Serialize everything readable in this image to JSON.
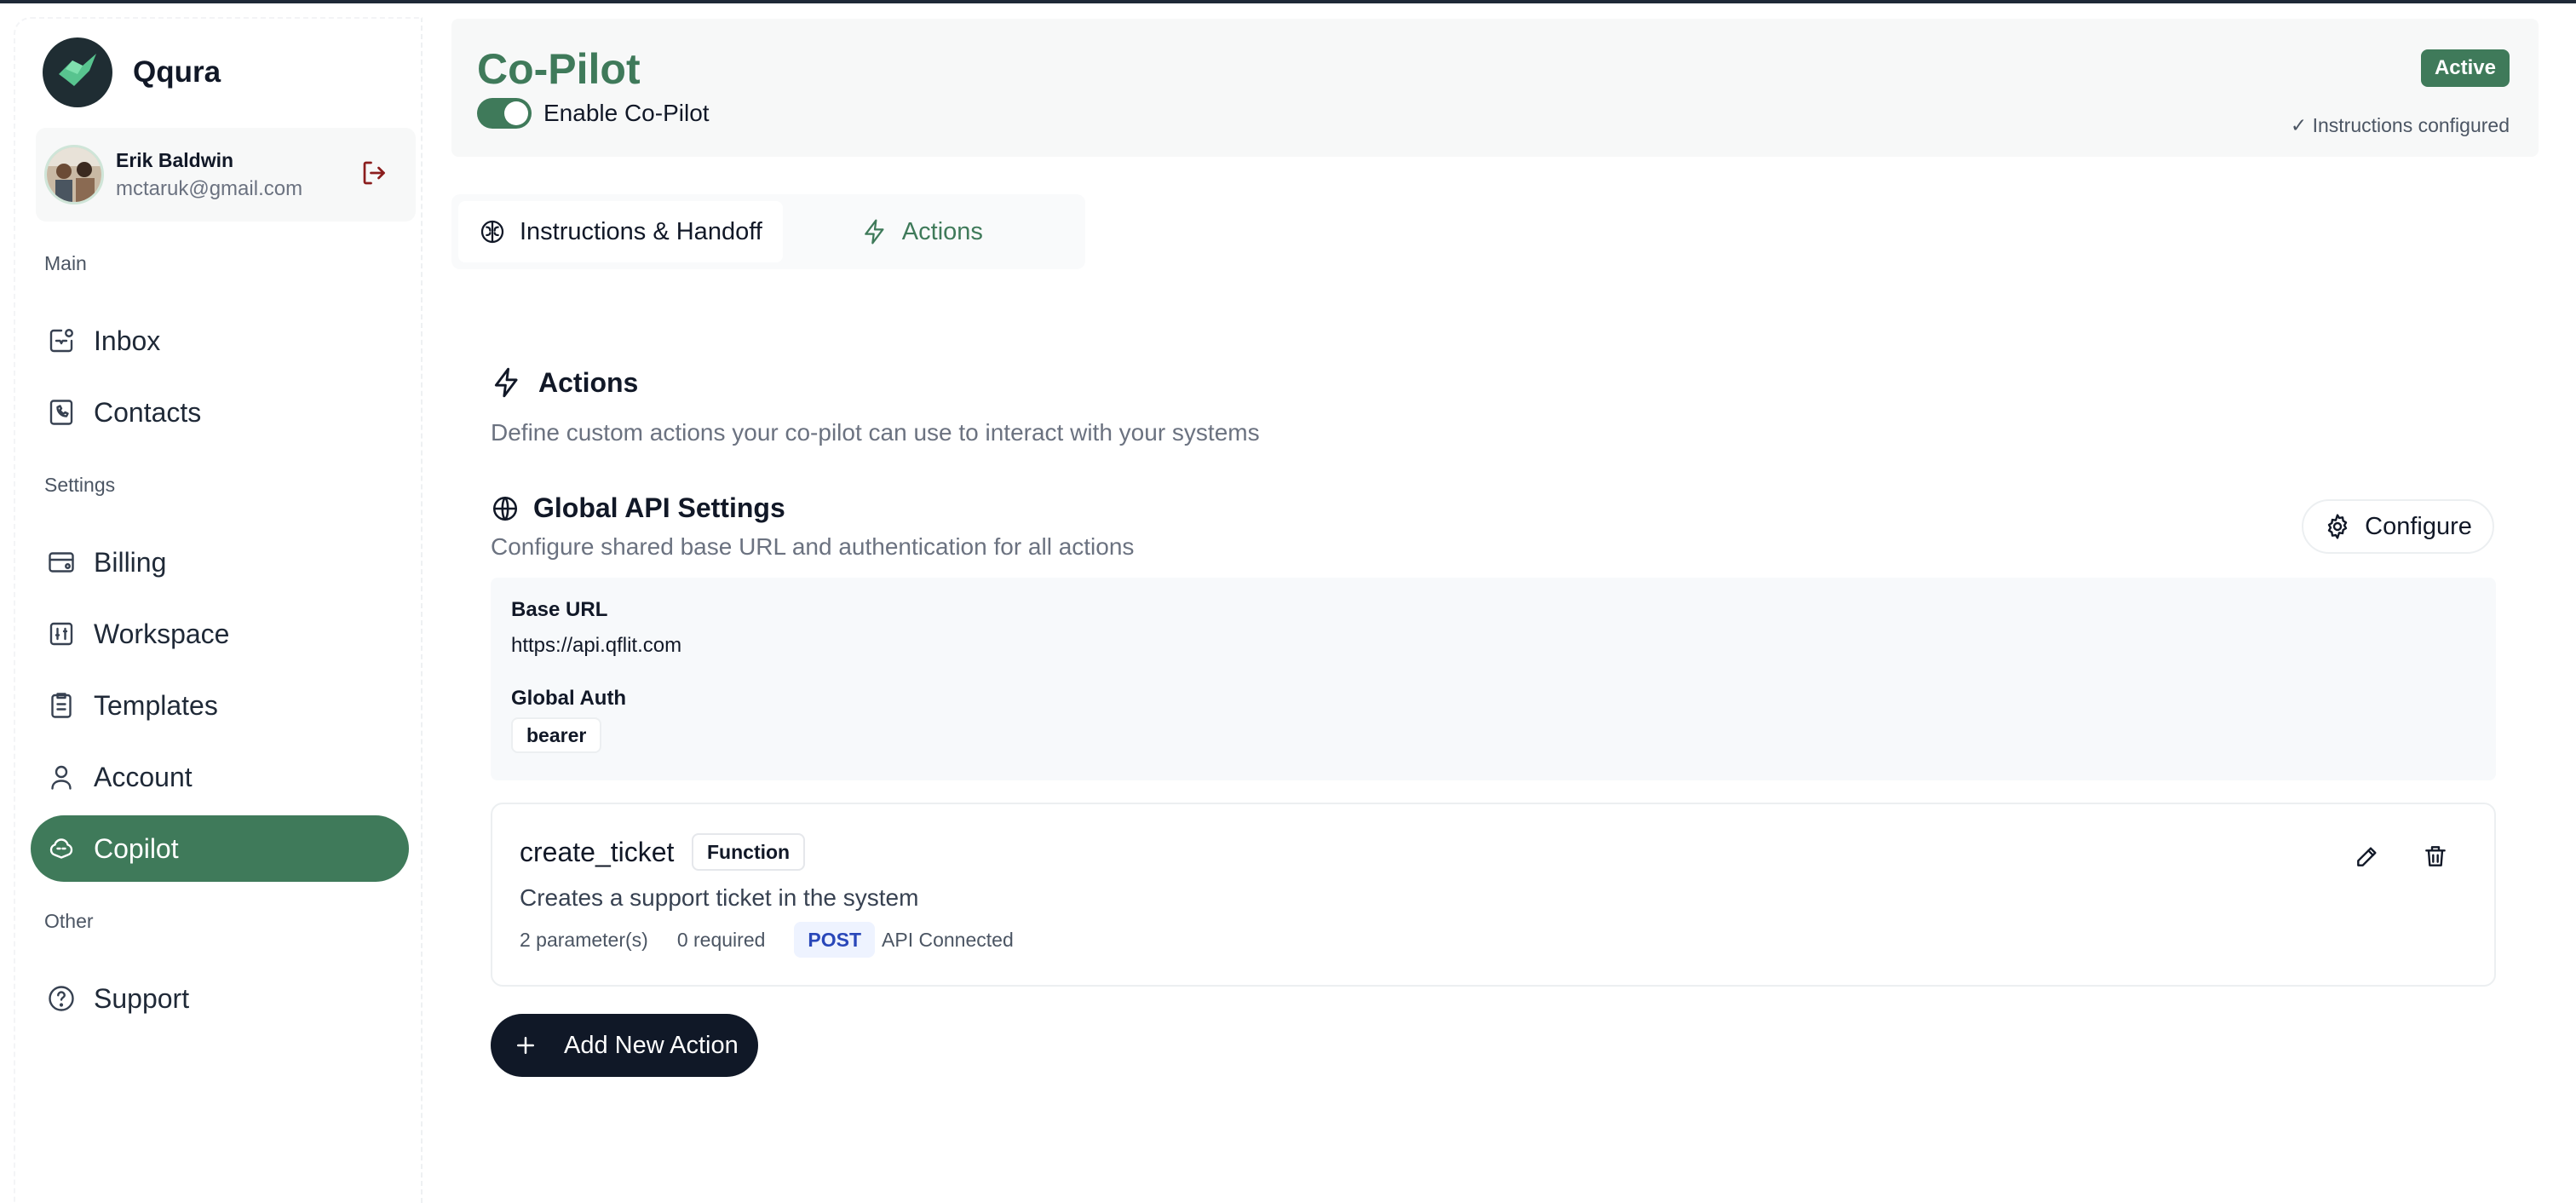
{
  "brand": {
    "name": "Qqura"
  },
  "user": {
    "name": "Erik Baldwin",
    "email": "mctaruk@gmail.com"
  },
  "sidebar": {
    "sections": [
      {
        "label": "Main",
        "items": [
          {
            "label": "Inbox",
            "icon": "inbox-icon"
          },
          {
            "label": "Contacts",
            "icon": "contacts-icon"
          }
        ]
      },
      {
        "label": "Settings",
        "items": [
          {
            "label": "Billing",
            "icon": "billing-icon"
          },
          {
            "label": "Workspace",
            "icon": "workspace-icon"
          },
          {
            "label": "Templates",
            "icon": "templates-icon"
          },
          {
            "label": "Account",
            "icon": "account-icon"
          },
          {
            "label": "Copilot",
            "icon": "copilot-icon",
            "active": true
          }
        ]
      },
      {
        "label": "Other",
        "items": [
          {
            "label": "Support",
            "icon": "support-icon"
          }
        ]
      }
    ]
  },
  "header": {
    "title": "Co-Pilot",
    "toggle_label": "Enable Co-Pilot",
    "toggle_on": true,
    "status": "Active",
    "instructions_status": "✓ Instructions configured"
  },
  "tabs": [
    {
      "label": "Instructions & Handoff",
      "active": true
    },
    {
      "label": "Actions",
      "active": false
    }
  ],
  "actions_section": {
    "title": "Actions",
    "description": "Define custom actions your co-pilot can use to interact with your systems"
  },
  "global_api": {
    "title": "Global API Settings",
    "description": "Configure shared base URL and authentication for all actions",
    "configure_label": "Configure",
    "base_url_label": "Base URL",
    "base_url": "https://api.qflit.com",
    "auth_label": "Global Auth",
    "auth_value": "bearer"
  },
  "action": {
    "name": "create_ticket",
    "type": "Function",
    "description": "Creates a support ticket in the system",
    "params": "2 parameter(s)",
    "required": "0 required",
    "method": "POST",
    "connection": "API Connected"
  },
  "add_action_label": "Add New Action",
  "colors": {
    "accent": "#3f7a5a",
    "dark": "#101827",
    "post_bg": "#eef3ff",
    "post_text": "#2947b9"
  }
}
